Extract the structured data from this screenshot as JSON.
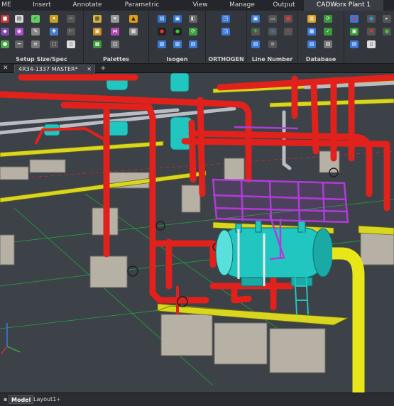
{
  "menu_tabs": [
    {
      "label": "ME",
      "active": false
    },
    {
      "label": "Insert",
      "active": false
    },
    {
      "label": "Annotate",
      "active": false
    },
    {
      "label": "Parametric",
      "active": false
    },
    {
      "label": "View",
      "active": false
    },
    {
      "label": "Manage",
      "active": false
    },
    {
      "label": "Output",
      "active": false
    },
    {
      "label": "CADWorx Plant 1",
      "active": true
    }
  ],
  "ribbon_panels": [
    {
      "title": "Setup Size/Spec"
    },
    {
      "title": "Palettes"
    },
    {
      "title": "Isogen"
    },
    {
      "title": "ORTHOGEN"
    },
    {
      "title": "Line Number"
    },
    {
      "title": "Database"
    }
  ],
  "document": {
    "tab_label": "4R34-1337 MASTER*",
    "close_glyph": "✕",
    "add_glyph": "+"
  },
  "layout_tabs": {
    "model": "Model",
    "layout1": "Layout1",
    "add": "+"
  },
  "colors": {
    "background": "#3d4148",
    "pipe_red": "#e0211c",
    "pipe_yellow": "#e8e619",
    "equipment_cyan": "#22c6c0",
    "platform_magenta": "#b03cd8",
    "steel_yellow": "#d8d61e",
    "concrete": "#b7b1a5",
    "grid_green": "#1fa83a"
  }
}
